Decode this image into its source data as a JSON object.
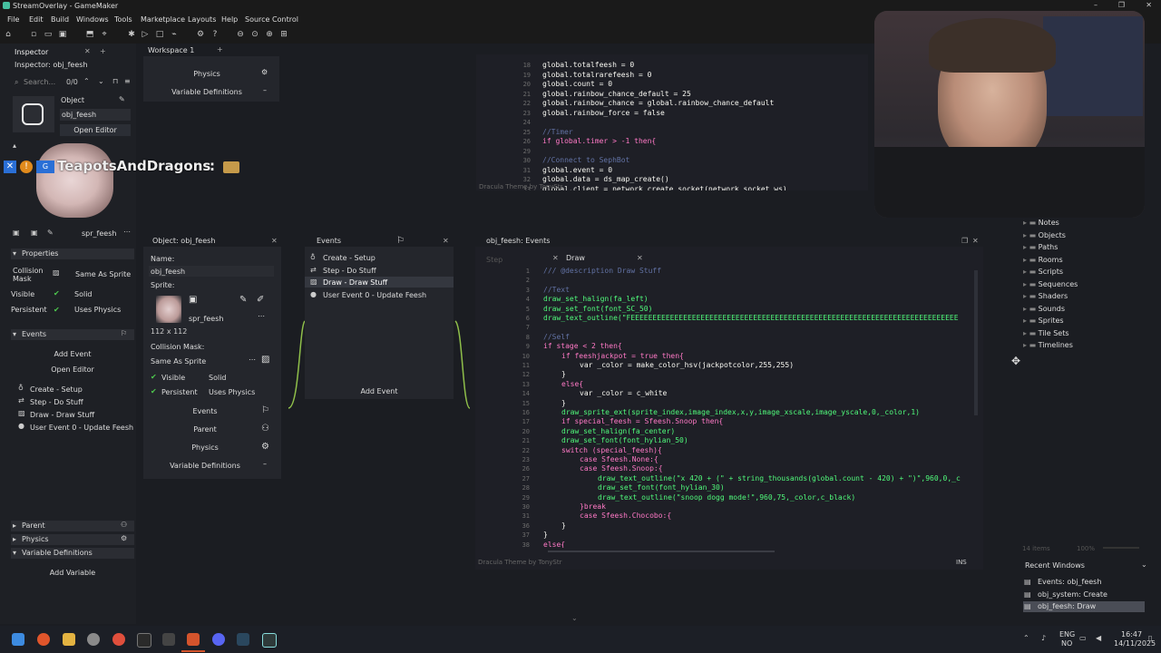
{
  "window": {
    "title": "StreamOverlay - GameMaker"
  },
  "menu": [
    "File",
    "Edit",
    "Build",
    "Windows",
    "Tools",
    "Marketplace",
    "Layouts",
    "Help",
    "Source Control"
  ],
  "inspector": {
    "tab": "Inspector",
    "title": "Inspector: obj_feesh",
    "search_placeholder": "Search...",
    "count": "0/0",
    "object_label": "Object",
    "object_name": "obj_feesh",
    "open_editor": "Open Editor",
    "sprite_name": "spr_feesh",
    "properties_header": "Properties",
    "collision_mask_label": "Collision Mask",
    "collision_mask_value": "Same As Sprite",
    "visible": "Visible",
    "solid": "Solid",
    "persistent": "Persistent",
    "uses_physics": "Uses Physics",
    "events_header": "Events",
    "add_event": "Add Event",
    "open_editor2": "Open Editor",
    "events": [
      "Create - Setup",
      "Step - Do Stuff",
      "Draw - Draw Stuff",
      "User Event 0 - Update Feesh"
    ],
    "parent_header": "Parent",
    "physics_header": "Physics",
    "vardefs_header": "Variable Definitions",
    "add_variable": "Add Variable"
  },
  "chat_overlay": {
    "username": "TeapotsAndDragons",
    "separator": ":"
  },
  "workspace": {
    "tab": "Workspace 1",
    "physics": "Physics",
    "variable_definitions": "Variable Definitions"
  },
  "object_panel": {
    "title": "Object: obj_feesh",
    "name_label": "Name:",
    "name_value": "obj_feesh",
    "sprite_label": "Sprite:",
    "sprite_value": "spr_feesh",
    "sprite_size": "112 x 112",
    "collision_mask_label": "Collision Mask:",
    "collision_mask_value": "Same As Sprite",
    "visible": "Visible",
    "solid": "Solid",
    "persistent": "Persistent",
    "uses_physics": "Uses Physics",
    "events": "Events",
    "parent": "Parent",
    "physics": "Physics",
    "variable_definitions": "Variable Definitions"
  },
  "events_panel": {
    "title": "Events",
    "items": [
      "Create - Setup",
      "Step - Do Stuff",
      "Draw - Draw Stuff",
      "User Event 0 - Update Feesh"
    ],
    "add_event": "Add Event"
  },
  "top_code": {
    "footer": "Dracula Theme by TonyStr",
    "lines": [
      {
        "n": "18",
        "text": "global.totalfeesh = 0"
      },
      {
        "n": "19",
        "text": "global.totalrarefeesh = 0"
      },
      {
        "n": "20",
        "text": "global.count = 0"
      },
      {
        "n": "21",
        "text": "global.rainbow_chance_default = 25"
      },
      {
        "n": "22",
        "text": "global.rainbow_chance = global.rainbow_chance_default"
      },
      {
        "n": "23",
        "text": "global.rainbow_force = false"
      },
      {
        "n": "24",
        "text": ""
      },
      {
        "n": "25",
        "text": "//Timer"
      },
      {
        "n": "26",
        "text": "if global.timer > -1 then{"
      },
      {
        "n": "29",
        "text": ""
      },
      {
        "n": "30",
        "text": "//Connect to SephBot"
      },
      {
        "n": "31",
        "text": "global.event = 0"
      },
      {
        "n": "32",
        "text": "global.data = ds_map_create()"
      },
      {
        "n": "33",
        "text": "global.client = network_create_socket(network_socket_ws)"
      }
    ]
  },
  "draw_editor": {
    "title": "obj_feesh: Events",
    "tab_step": "Step",
    "tab_draw": "Draw",
    "footer": "Dracula Theme by TonyStr",
    "mode": "INS",
    "lines": [
      {
        "n": "1",
        "indent": 0,
        "text": "/// @description Draw Stuff",
        "cls": "c-cm"
      },
      {
        "n": "2",
        "indent": 0,
        "text": "",
        "cls": "c-var"
      },
      {
        "n": "3",
        "indent": 0,
        "text": "//Text",
        "cls": "c-cm"
      },
      {
        "n": "4",
        "indent": 0,
        "text": "draw_set_halign(fa_left)",
        "cls": "c-fn"
      },
      {
        "n": "5",
        "indent": 0,
        "text": "draw_set_font(font_SC_50)",
        "cls": "c-fn"
      },
      {
        "n": "6",
        "indent": 0,
        "text": "draw_text_outline(\"FEEEEEEEEEEEEEEEEEEEEEEEEEEEEEEEEEEEEEEEEEEEEEEEEEEEEEEEEEEEEEEEEEEEEEEEEEEE",
        "cls": "c-fn"
      },
      {
        "n": "7",
        "indent": 0,
        "text": "",
        "cls": "c-var"
      },
      {
        "n": "8",
        "indent": 0,
        "text": "//Self",
        "cls": "c-cm"
      },
      {
        "n": "9",
        "indent": 0,
        "text": "if stage < 2 then{",
        "cls": "c-kw"
      },
      {
        "n": "10",
        "indent": 1,
        "text": "if feeshjackpot = true then{",
        "cls": "c-kw"
      },
      {
        "n": "11",
        "indent": 2,
        "text": "var _color = make_color_hsv(jackpotcolor,255,255)",
        "cls": "c-var"
      },
      {
        "n": "12",
        "indent": 1,
        "text": "}",
        "cls": "c-var"
      },
      {
        "n": "13",
        "indent": 1,
        "text": "else{",
        "cls": "c-kw"
      },
      {
        "n": "14",
        "indent": 2,
        "text": "var _color = c_white",
        "cls": "c-var"
      },
      {
        "n": "15",
        "indent": 1,
        "text": "}",
        "cls": "c-var"
      },
      {
        "n": "16",
        "indent": 1,
        "text": "draw_sprite_ext(sprite_index,image_index,x,y,image_xscale,image_yscale,0,_color,1)",
        "cls": "c-fn"
      },
      {
        "n": "17",
        "indent": 1,
        "text": "if special_feesh = Sfeesh.Snoop then{",
        "cls": "c-kw"
      },
      {
        "n": "20",
        "indent": 1,
        "text": "draw_set_halign(fa_center)",
        "cls": "c-fn"
      },
      {
        "n": "21",
        "indent": 1,
        "text": "draw_set_font(font_hylian_50)",
        "cls": "c-fn"
      },
      {
        "n": "22",
        "indent": 1,
        "text": "switch (special_feesh){",
        "cls": "c-kw"
      },
      {
        "n": "23",
        "indent": 2,
        "text": "case Sfeesh.None:{",
        "cls": "c-kw"
      },
      {
        "n": "26",
        "indent": 2,
        "text": "case Sfeesh.Snoop:{",
        "cls": "c-kw"
      },
      {
        "n": "27",
        "indent": 3,
        "text": "draw_text_outline(\"x 420 + (\" + string_thousands(global.count - 420) + \")\",960,0,_c",
        "cls": "c-fn"
      },
      {
        "n": "28",
        "indent": 3,
        "text": "draw_set_font(font_hylian_30)",
        "cls": "c-fn"
      },
      {
        "n": "29",
        "indent": 3,
        "text": "draw_text_outline(\"snoop dogg mode!\",960,75,_color,c_black)",
        "cls": "c-fn"
      },
      {
        "n": "30",
        "indent": 2,
        "text": "}break",
        "cls": "c-kw"
      },
      {
        "n": "31",
        "indent": 2,
        "text": "case Sfeesh.Chocobo:{",
        "cls": "c-kw"
      },
      {
        "n": "36",
        "indent": 1,
        "text": "}",
        "cls": "c-var"
      },
      {
        "n": "37",
        "indent": 0,
        "text": "}",
        "cls": "c-var"
      },
      {
        "n": "38",
        "indent": 0,
        "text": "else{",
        "cls": "c-kw"
      }
    ]
  },
  "asset_tree": [
    "Notes",
    "Objects",
    "Paths",
    "Rooms",
    "Scripts",
    "Sequences",
    "Shaders",
    "Sounds",
    "Sprites",
    "Tile Sets",
    "Timelines"
  ],
  "asset_footer": {
    "items": "14 items",
    "zoom": "100%"
  },
  "recent_windows": {
    "title": "Recent Windows",
    "items": [
      "Events: obj_feesh",
      "obj_system: Create",
      "obj_feesh: Draw"
    ]
  },
  "taskbar": {
    "lang": "ENG",
    "region": "NO",
    "time": "16:47",
    "date": "14/11/2025"
  },
  "colors": {
    "accent": "#d4542c",
    "bg": "#1b1d22",
    "panel": "#24262c"
  }
}
